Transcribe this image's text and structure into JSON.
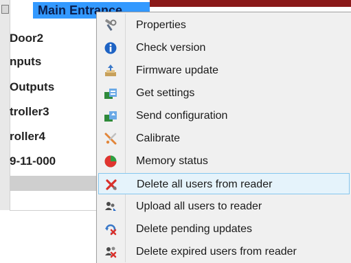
{
  "tree": {
    "selected_node": "Main Entrance",
    "items": [
      {
        "label": "Door2"
      },
      {
        "label": "nputs"
      },
      {
        "label": "Outputs"
      },
      {
        "label": "troller3"
      },
      {
        "label": "roller4"
      },
      {
        "label": "9-11-000"
      }
    ]
  },
  "context_menu": {
    "items": [
      {
        "label": "Properties",
        "icon": "properties-icon"
      },
      {
        "label": "Check version",
        "icon": "info-icon"
      },
      {
        "label": "Firmware update",
        "icon": "firmware-update-icon"
      },
      {
        "label": "Get settings",
        "icon": "get-settings-icon"
      },
      {
        "label": "Send configuration",
        "icon": "send-configuration-icon"
      },
      {
        "label": "Calibrate",
        "icon": "calibrate-icon"
      },
      {
        "label": "Memory status",
        "icon": "memory-status-icon"
      },
      {
        "label": "Delete all users from reader",
        "icon": "delete-users-icon",
        "highlighted": true
      },
      {
        "label": "Upload all users to reader",
        "icon": "upload-users-icon"
      },
      {
        "label": "Delete pending updates",
        "icon": "delete-pending-icon"
      },
      {
        "label": "Delete expired users from reader",
        "icon": "delete-expired-icon"
      }
    ]
  },
  "colors": {
    "selection": "#3399ff",
    "menu_background": "#f0f0f0",
    "menu_highlight": "#e5f3fb",
    "menu_highlight_border": "#84c6ee",
    "header_bar": "#8b1a1a"
  }
}
